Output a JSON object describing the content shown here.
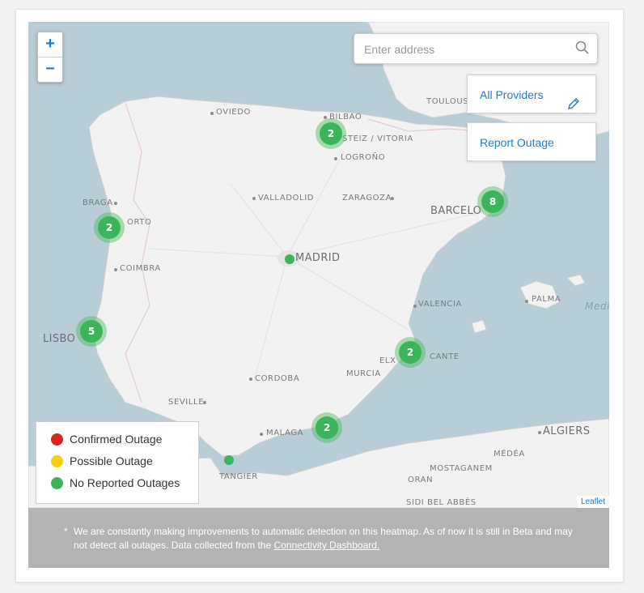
{
  "zoom": {
    "in_label": "+",
    "out_label": "−"
  },
  "search": {
    "placeholder": "Enter address",
    "icon": "search-icon"
  },
  "buttons": {
    "providers_label": "All Providers",
    "report_label": "Report Outage"
  },
  "cities": {
    "toulouse": "TOULOUS",
    "bilbao": "BILBAO",
    "oviedo": "OVIEDO",
    "vitoria": "STEIZ / VITORIA",
    "logrono": "LOGROÑO",
    "braga": "BRAGA",
    "porto": "ORTO",
    "valladolid": "VALLADOLID",
    "zaragoza": "ZARAGOZA",
    "barcelona": "BARCELO",
    "madrid": "MADRID",
    "coimbra": "COIMBRA",
    "lisbon": "LISBO",
    "valencia": "VALENCIA",
    "palma": "PALMA",
    "medi": "Medi",
    "elx": "ELX",
    "alicante": "CANTE",
    "murcia": "MURCIA",
    "cordoba": "CORDOBA",
    "seville": "SEVILLE",
    "malaga": "MALAGA",
    "algiers": "ALGIERS",
    "medea": "MÉDÉA",
    "tangier": "TANGIER",
    "mostaganem": "MOSTAGANEM",
    "oran": "ORAN",
    "sidi": "SIDI BEL ABBÈS"
  },
  "clusters": [
    {
      "id": "north",
      "count": "2"
    },
    {
      "id": "porto",
      "count": "2"
    },
    {
      "id": "barcelona",
      "count": "8"
    },
    {
      "id": "lisbon",
      "count": "5"
    },
    {
      "id": "alicante",
      "count": "2"
    },
    {
      "id": "malaga",
      "count": "2"
    }
  ],
  "legend": {
    "items": [
      {
        "label": "Confirmed Outage",
        "color": "#d7261e"
      },
      {
        "label": "Possible Outage",
        "color": "#f5d00f"
      },
      {
        "label": "No Reported Outages",
        "color": "#3cb55a"
      }
    ]
  },
  "attribution": "Leaflet",
  "footer": {
    "star": "*",
    "text": "We are constantly making improvements to automatic detection on this heatmap. As of now it is still in Beta and may not detect all outages. Data collected from the ",
    "link": "Connectivity Dashboard."
  }
}
